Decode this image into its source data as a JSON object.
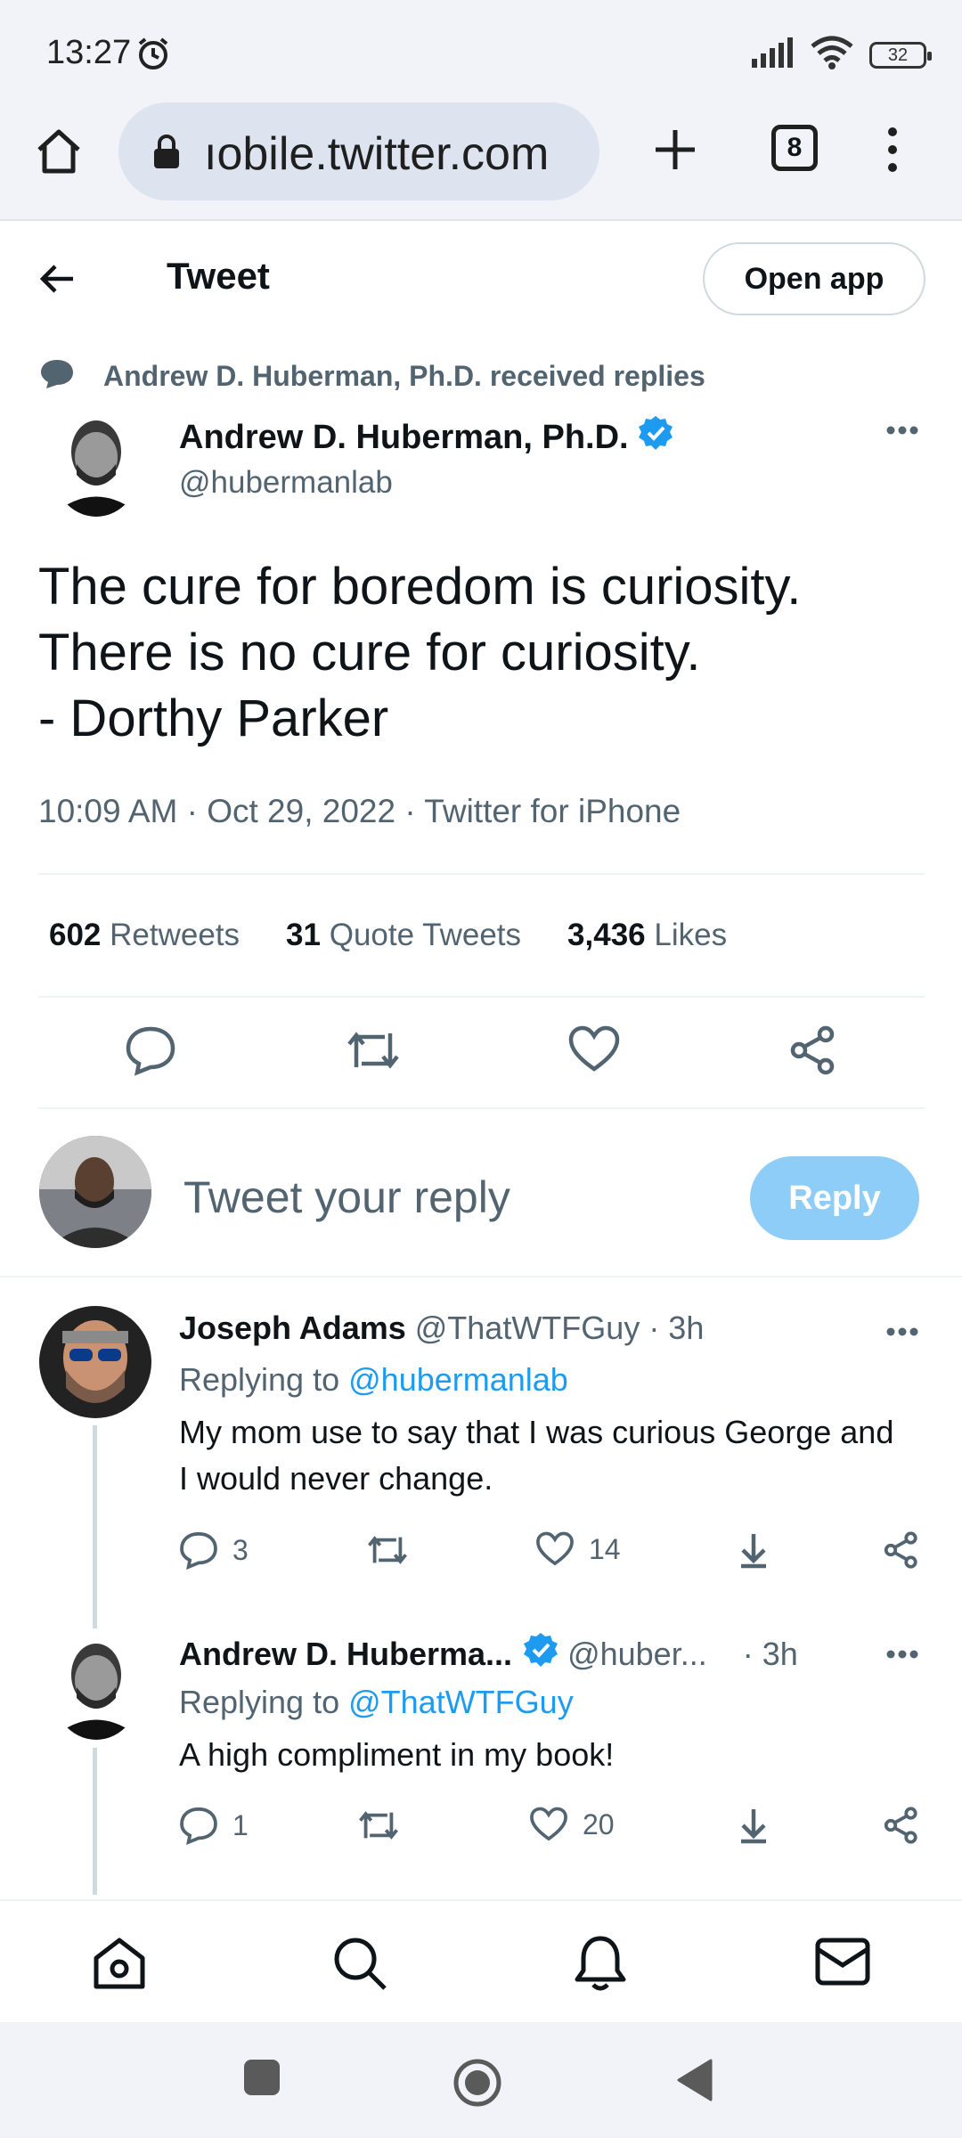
{
  "status_bar": {
    "time": "13:27",
    "battery": "32"
  },
  "browser": {
    "url": "mobile.twitter.com",
    "url_display": "ıobile.twitter.com",
    "tab_count": "8"
  },
  "header": {
    "title": "Tweet",
    "open_app": "Open app"
  },
  "tweet": {
    "context": "Andrew D. Huberman, Ph.D. received replies",
    "author_name": "Andrew D. Huberman, Ph.D.",
    "author_handle": "@hubermanlab",
    "text": "The cure for boredom is curiosity.\nThere is no cure for curiosity.\n- Dorthy Parker",
    "meta": "10:09 AM · Oct 29, 2022 · Twitter for iPhone",
    "retweets_count": "602",
    "retweets_label": "Retweets",
    "quotes_count": "31",
    "quotes_label": "Quote Tweets",
    "likes_count": "3,436",
    "likes_label": "Likes"
  },
  "compose": {
    "placeholder": "Tweet your reply",
    "reply_button": "Reply"
  },
  "replies": [
    {
      "name": "Joseph Adams",
      "handle": "@ThatWTFGuy · 3h",
      "replying_prefix": "Replying to",
      "replying_to": "@hubermanlab",
      "text": "My mom use to say that I was curious George and I would never change.",
      "reply_count": "3",
      "like_count": "14"
    },
    {
      "name": "Andrew D. Huberma...",
      "handle": "@huber...",
      "time": "· 3h",
      "replying_prefix": "Replying to",
      "replying_to": "@ThatWTFGuy",
      "text": "A high compliment in my book!",
      "reply_count": "1",
      "like_count": "20"
    }
  ],
  "colors": {
    "accent": "#1d9bf0",
    "reply_button_disabled": "#8ecdf8",
    "secondary_text": "#536471"
  }
}
